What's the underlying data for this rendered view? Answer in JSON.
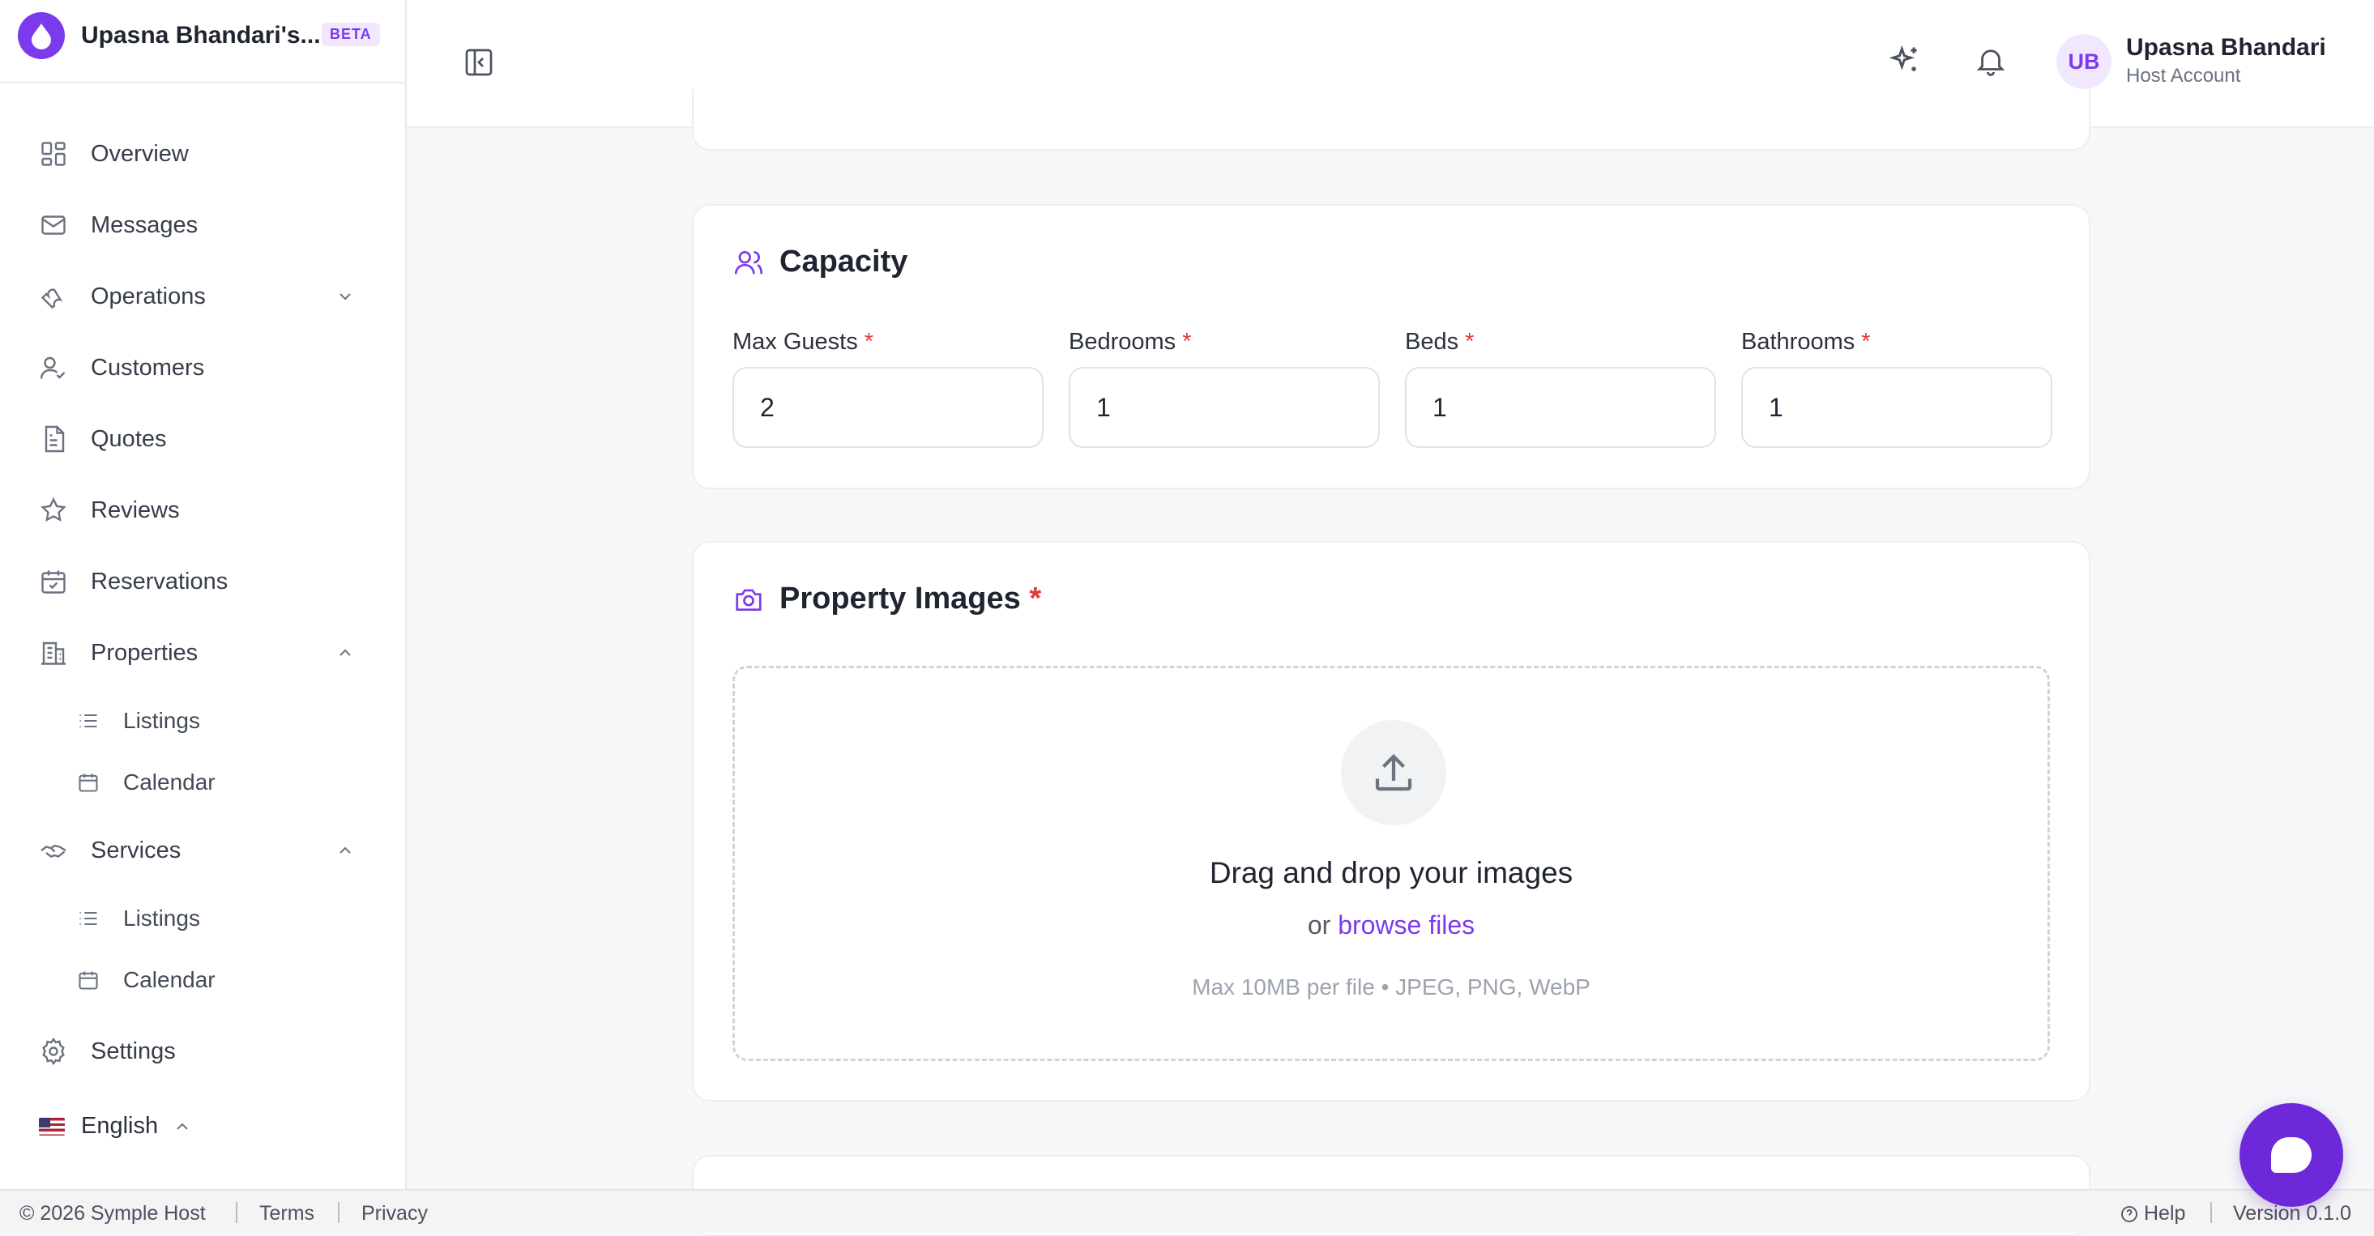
{
  "brand": {
    "name": "Upasna Bhandari's...",
    "badge": "BETA"
  },
  "sidebar": {
    "items": [
      {
        "label": "Overview",
        "icon": "overview-grid-icon"
      },
      {
        "label": "Messages",
        "icon": "mail-icon"
      },
      {
        "label": "Operations",
        "icon": "wrench-icon",
        "expanded": false
      },
      {
        "label": "Customers",
        "icon": "user-check-icon"
      },
      {
        "label": "Quotes",
        "icon": "document-icon"
      },
      {
        "label": "Reviews",
        "icon": "star-icon"
      },
      {
        "label": "Reservations",
        "icon": "calendar-check-icon"
      },
      {
        "label": "Properties",
        "icon": "building-icon",
        "expanded": true,
        "children": [
          {
            "label": "Listings",
            "icon": "list-icon"
          },
          {
            "label": "Calendar",
            "icon": "calendar-icon"
          }
        ]
      },
      {
        "label": "Services",
        "icon": "handshake-icon",
        "expanded": true,
        "children": [
          {
            "label": "Listings",
            "icon": "list-icon"
          },
          {
            "label": "Calendar",
            "icon": "calendar-icon"
          }
        ]
      },
      {
        "label": "Settings",
        "icon": "gear-icon"
      }
    ],
    "language": {
      "label": "English",
      "flag": "us-flag-icon"
    }
  },
  "header": {
    "user": {
      "initials": "UB",
      "name": "Upasna Bhandari",
      "role": "Host Account"
    }
  },
  "capacity": {
    "title": "Capacity",
    "fields": [
      {
        "label": "Max Guests",
        "required_mark": "*",
        "value": "2"
      },
      {
        "label": "Bedrooms",
        "required_mark": "*",
        "value": "1"
      },
      {
        "label": "Beds",
        "required_mark": "*",
        "value": "1"
      },
      {
        "label": "Bathrooms",
        "required_mark": "*",
        "value": "1"
      }
    ]
  },
  "images": {
    "title": "Property Images",
    "required_mark": "*",
    "dropzone": {
      "title": "Drag and drop your images",
      "or_text": "or",
      "browse_label": "browse files",
      "hint": "Max 10MB per file • JPEG, PNG, WebP"
    }
  },
  "footer": {
    "copyright": "© 2026 Symple Host",
    "terms": "Terms",
    "privacy": "Privacy",
    "help": "Help",
    "version": "Version 0.1.0"
  },
  "colors": {
    "accent": "#7c3aed",
    "chat": "#6d28d9",
    "required": "#e03a3a"
  }
}
